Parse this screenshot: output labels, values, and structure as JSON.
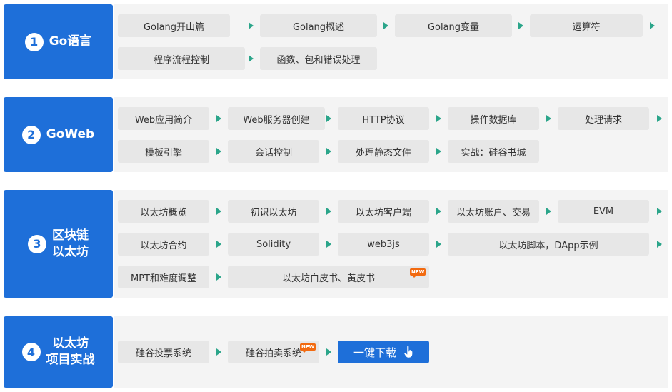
{
  "sections": [
    {
      "number": "1",
      "title_line1": "Go语言",
      "title_line2": "",
      "items": [
        "Golang开山篇",
        "Golang概述",
        "Golang变量",
        "运算符",
        "程序流程控制",
        "函数、包和错误处理"
      ]
    },
    {
      "number": "2",
      "title_line1": "GoWeb",
      "title_line2": "",
      "items": [
        "Web应用简介",
        "Web服务器创建",
        "HTTP协议",
        "操作数据库",
        "处理请求",
        "模板引擎",
        "会话控制",
        "处理静态文件",
        "实战：硅谷书城"
      ]
    },
    {
      "number": "3",
      "title_line1": "区块链",
      "title_line2": "以太坊",
      "items": [
        "以太坊概览",
        "初识以太坊",
        "以太坊客户端",
        "以太坊账户、交易",
        "EVM",
        "以太坊合约",
        "Solidity",
        "web3js",
        "以太坊脚本，DApp示例",
        "MPT和难度调整",
        "以太坊白皮书、黄皮书"
      ]
    },
    {
      "number": "4",
      "title_line1": "以太坊",
      "title_line2": "项目实战",
      "items": [
        "硅谷投票系统",
        "硅谷拍卖系统"
      ]
    }
  ],
  "badge_label": "NEW",
  "download_label": "一键下载",
  "colors": {
    "primary": "#1e6fd9",
    "arrow": "#2ba58a",
    "badge": "#f26a10",
    "item_bg": "#e7e7e7",
    "row_bg": "#f4f4f4"
  },
  "icons": {
    "arrow": "triangle-right-icon",
    "cursor": "hand-pointer-icon"
  }
}
